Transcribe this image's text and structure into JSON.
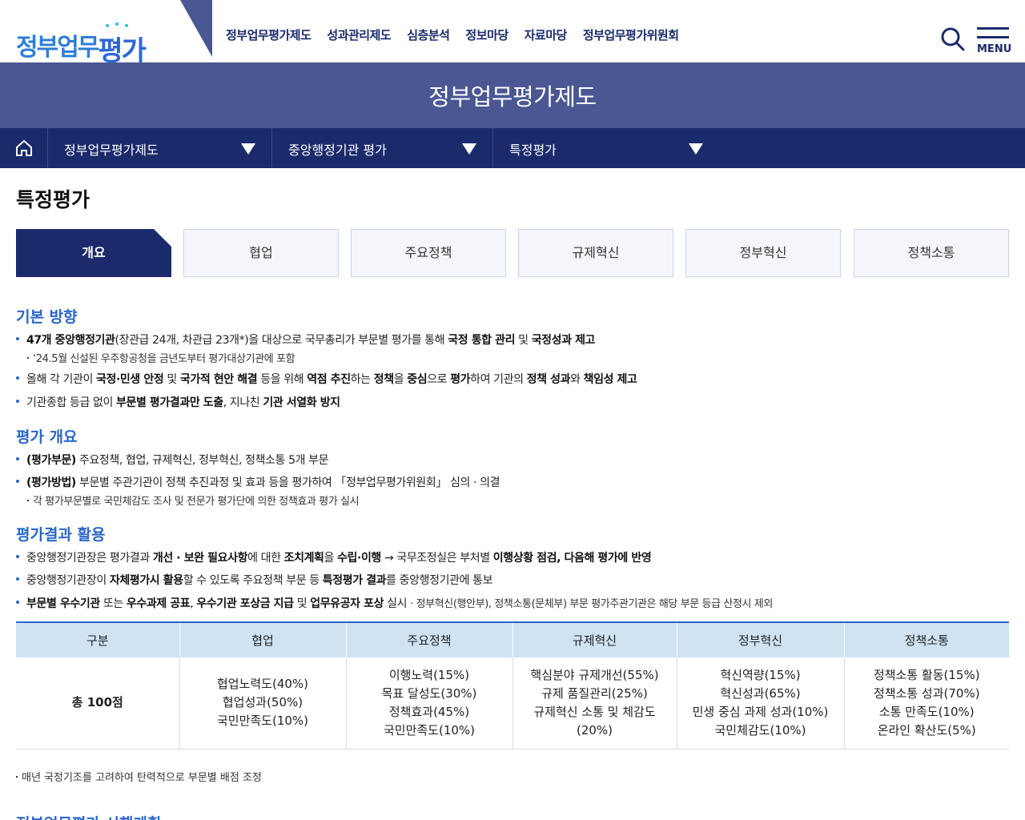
{
  "header": {
    "logo_main": "정부업무",
    "logo_sub": "평가",
    "gnb": [
      "정부업무평가제도",
      "성과관리제도",
      "심층분석",
      "정보마당",
      "자료마당",
      "정부업무평가위원회"
    ],
    "menu_label": "MENU"
  },
  "banner": {
    "title": "정부업무평가제도"
  },
  "location": {
    "segments": [
      "정부업무평가제도",
      "중앙행정기관 평가",
      "특정평가"
    ]
  },
  "page": {
    "title": "특정평가"
  },
  "tabs": [
    "개요",
    "협업",
    "주요정책",
    "규제혁신",
    "정부혁신",
    "정책소통"
  ],
  "sections": {
    "basic": {
      "title": "기본 방향",
      "item1": {
        "p1": "47개 중앙행정기관",
        "p2": "(장관급 24개, 차관급 23개*)을 대상으로 국무총리가 부문별 평가를 통해 ",
        "p3": "국정 통합 관리",
        "p4": " 및 ",
        "p5": "국정성과 제고"
      },
      "item1_sub": "‘24.5월 신설된 우주항공청을 금년도부터 평가대상기관에 포함",
      "item2": {
        "p1": "올해 각 기관이 ",
        "p2": "국정·민생 안정",
        "p3": " 및 ",
        "p4": "국가적 현안 해결",
        "p5": " 등을 위해 ",
        "p6": "역점 추진",
        "p7": "하는 ",
        "p8": "정책",
        "p9": "을 ",
        "p10": "중심",
        "p11": "으로 ",
        "p12": "평가",
        "p13": "하여 기관의 ",
        "p14": "정책 성과",
        "p15": "와 ",
        "p16": "책임성 제고"
      },
      "item3": {
        "p1": "기관종합 등급 없이 ",
        "p2": "부문별 평가결과만 도출",
        "p3": ", 지나친 ",
        "p4": "기관 서열화 방지"
      }
    },
    "overview": {
      "title": "평가 개요",
      "item1": {
        "p1": "(평가부문)",
        "p2": " 주요정책, 협업, 규제혁신, 정부혁신, 정책소통 5개 부문"
      },
      "item2": {
        "p1": "(평가방법)",
        "p2": " 부문별 주관기관이 정책 추진과정 및 효과 등을 평가하여 「정부업무평가위원회」 심의 · 의결"
      },
      "item2_sub": "각 평가부문별로 국민체감도 조사 및 전문가 평가단에 의한 정책효과 평가 실시"
    },
    "usage": {
      "title": "평가결과 활용",
      "item1": {
        "p1": "중앙행정기관장은 평가결과 ",
        "p2": "개선 · 보완 필요사항",
        "p3": "에 대한 ",
        "p4": "조치계획",
        "p5": "을 ",
        "p6": "수립·이행",
        "p7": " → 국무조정실은 부처별 ",
        "p8": "이행상황 점검, 다음해 평가에 반영"
      },
      "item2": {
        "p1": "중앙행정기관장이 ",
        "p2": "자체평가시 활용",
        "p3": "할 수 있도록 주요정책 부문 등 ",
        "p4": "특정평가 결과",
        "p5": "를 중앙행정기관에 통보"
      },
      "item3": {
        "p1": "부문별 우수기관",
        "p2": " 또는 ",
        "p3": "우수과제 공표",
        "p4": ", ",
        "p5": "우수기관 포상금 지급",
        "p6": " 및 ",
        "p7": "업무유공자 포상",
        "p8": " 실시 ",
        "p9": "· 정부혁신(행안부), 정책소통(문체부) 부문 평가주관기관은 해당 부문 등급 산정시 제외"
      }
    }
  },
  "table": {
    "headers": [
      "구분",
      "협업",
      "주요정책",
      "규제혁신",
      "정부혁신",
      "정책소통"
    ],
    "row_label": "총 100점",
    "cells": [
      [
        "협업노력도(40%)",
        "협업성과(50%)",
        "국민만족도(10%)"
      ],
      [
        "이행노력(15%)",
        "목표 달성도(30%)",
        "정책효과(45%)",
        "국민만족도(10%)"
      ],
      [
        "핵심분야 규제개선(55%)",
        "규제 품질관리(25%)",
        "규제혁신 소통 및 체감도",
        "(20%)"
      ],
      [
        "혁신역량(15%)",
        "혁신성과(65%)",
        "민생 중심 과제 성과(10%)",
        "국민체감도(10%)"
      ],
      [
        "정책소통 활동(15%)",
        "정책소통 성과(70%)",
        "소통 만족도(10%)",
        "온라인 확산도(5%)"
      ]
    ]
  },
  "footnote": "매년 국정기조를 고려하여 탄력적으로 부문별 배점 조정",
  "next_section_title": "정부업무평가 시행계획",
  "colors": {
    "navy": "#1a2a6b",
    "header_blue": "#4a5793",
    "accent_blue": "#2a66c6",
    "table_head": "#cfe3f3"
  }
}
